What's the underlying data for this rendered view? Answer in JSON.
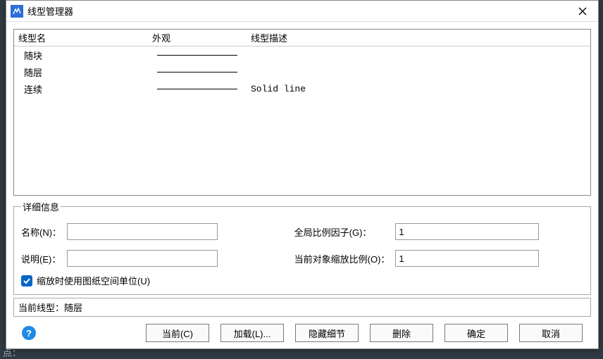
{
  "title": "线型管理器",
  "columns": {
    "name": "线型名",
    "appearance": "外观",
    "desc": "线型描述"
  },
  "rows": [
    {
      "name": "随块",
      "desc": ""
    },
    {
      "name": "随层",
      "desc": ""
    },
    {
      "name": "连续",
      "desc": "Solid line"
    }
  ],
  "details": {
    "legend": "详细信息",
    "name_label": "名称(N)：",
    "name_value": "",
    "desc_label": "说明(E)：",
    "desc_value": "",
    "global_label": "全局比例因子(G)：",
    "global_value": "1",
    "current_scale_label": "当前对象缩放比例(O)：",
    "current_scale_value": "1",
    "checkbox_label": "缩放时使用图纸空间单位(U)"
  },
  "current_prefix": "当前线型：",
  "current_value": "随层",
  "buttons": {
    "current": "当前(C)",
    "load": "加载(L)...",
    "hide": "隐藏细节",
    "delete": "删除",
    "ok": "确定",
    "cancel": "取消"
  },
  "bg": {
    "bottom_left": "点："
  }
}
